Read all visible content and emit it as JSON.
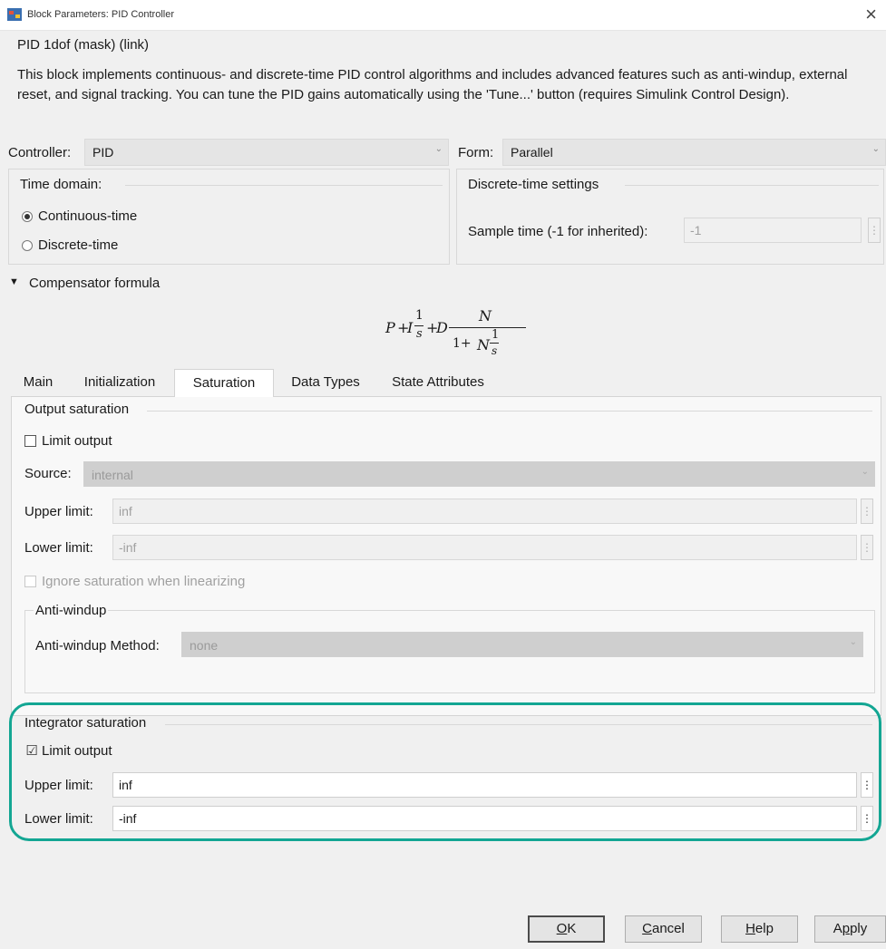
{
  "window": {
    "title": "Block Parameters: PID Controller",
    "close_glyph": "×"
  },
  "block": {
    "name": "PID 1dof (mask) (link)",
    "description": "This block implements continuous- and discrete-time PID control algorithms and includes advanced features such as anti-windup, external reset, and signal tracking. You can tune the PID gains automatically using the 'Tune...' button (requires Simulink Control Design)."
  },
  "controller": {
    "label": "Controller:",
    "value": "PID"
  },
  "form": {
    "label": "Form:",
    "value": "Parallel"
  },
  "time_domain": {
    "label": "Time domain:",
    "options": [
      "Continuous-time",
      "Discrete-time"
    ],
    "selected": "Continuous-time"
  },
  "discrete_settings": {
    "label": "Discrete-time settings",
    "sample_time_label": "Sample time (-1 for inherited):",
    "sample_time_value": "-1"
  },
  "compensator": {
    "label": "Compensator formula",
    "formula": {
      "P": "P",
      "I": "I",
      "D": "D",
      "N": "N",
      "one": "1",
      "s": "s",
      "plus": "+",
      "onep": "1+"
    }
  },
  "tabs": [
    "Main",
    "Initialization",
    "Saturation",
    "Data Types",
    "State Attributes"
  ],
  "active_tab": "Saturation",
  "output_saturation": {
    "label": "Output saturation",
    "limit_output_label": "Limit output",
    "limit_output_checked": false,
    "source_label": "Source:",
    "source_value": "internal",
    "upper_label": "Upper limit:",
    "upper_value": "inf",
    "lower_label": "Lower limit:",
    "lower_value": "-inf",
    "ignore_label": "Ignore saturation when linearizing",
    "ignore_checked": false
  },
  "anti_windup": {
    "label": "Anti-windup",
    "method_label": "Anti-windup Method:",
    "method_value": "none"
  },
  "integrator_saturation": {
    "label": "Integrator saturation",
    "limit_output_label": "Limit output",
    "limit_output_checked": true,
    "check_glyph": "☑",
    "upper_label": "Upper limit:",
    "upper_value": "inf",
    "lower_label": "Lower limit:",
    "lower_value": "-inf"
  },
  "menu_glyph": "⋮",
  "chevron_glyph": "⌄",
  "buttons": {
    "ok": {
      "accel": "O",
      "rest": "K"
    },
    "cancel": {
      "accel": "C",
      "rest": "ancel"
    },
    "help": {
      "accel": "H",
      "rest": "elp"
    },
    "apply": {
      "pre": "A",
      "accel": "p",
      "rest": "ply"
    }
  },
  "colors": {
    "highlight": "#13a693"
  }
}
